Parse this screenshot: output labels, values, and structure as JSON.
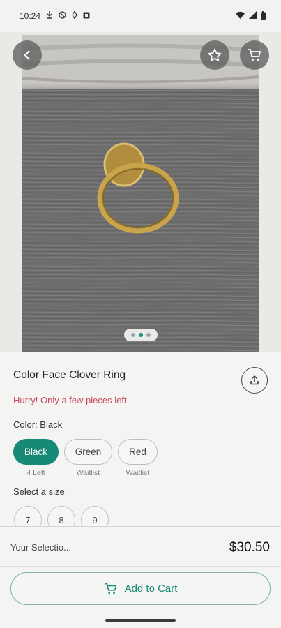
{
  "status_bar": {
    "time": "10:24",
    "icons_left": [
      "download-icon",
      "dnd-icon",
      "nfc-icon",
      "notification-icon"
    ],
    "icons_right": [
      "wifi-icon",
      "signal-icon",
      "battery-icon"
    ]
  },
  "hero": {
    "dots_count": 3,
    "active_dot": 1
  },
  "product": {
    "title": "Color Face Clover Ring",
    "urgency": "Hurry! Only a few pieces left.",
    "color_label": "Color: Black",
    "colors": [
      {
        "label": "Black",
        "sub": "4 Left",
        "selected": true
      },
      {
        "label": "Green",
        "sub": "Waitlist",
        "selected": false
      },
      {
        "label": "Red",
        "sub": "Waitlist",
        "selected": false
      }
    ],
    "size_label": "Select a size",
    "sizes": [
      "7",
      "8",
      "9"
    ]
  },
  "bottom": {
    "selection_label": "Your Selectio...",
    "price": "$30.50",
    "add_to_cart": "Add to Cart"
  },
  "colors": {
    "accent": "#168a74",
    "urgency": "#c9485f"
  }
}
